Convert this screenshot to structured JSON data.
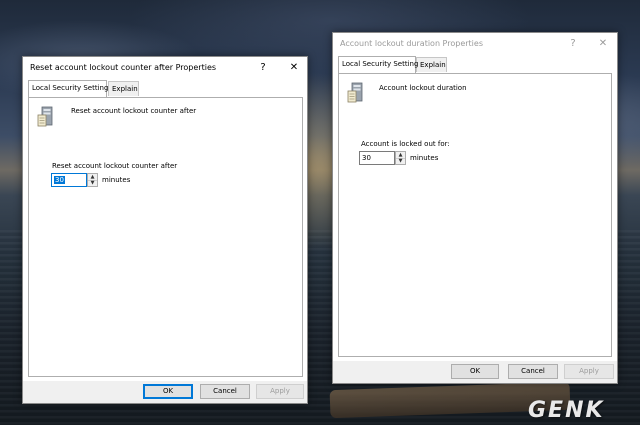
{
  "dialogs": {
    "left": {
      "title": "Reset account lockout counter after Properties",
      "help": "?",
      "close": "✕",
      "tabs": [
        "Local Security Setting",
        "Explain"
      ],
      "policy_name": "Reset account lockout counter after",
      "field_label": "Reset account lockout counter after",
      "value": "30",
      "unit": "minutes",
      "buttons": {
        "ok": "OK",
        "cancel": "Cancel",
        "apply": "Apply"
      }
    },
    "right": {
      "title": "Account lockout duration Properties",
      "help": "?",
      "close": "✕",
      "tabs": [
        "Local Security Setting",
        "Explain"
      ],
      "policy_name": "Account lockout duration",
      "field_label": "Account is locked out for:",
      "value": "30",
      "unit": "minutes",
      "buttons": {
        "ok": "OK",
        "cancel": "Cancel",
        "apply": "Apply"
      }
    }
  },
  "watermark": "GENK",
  "colors": {
    "accent": "#0078d7",
    "disabled_text": "#9c9c9c"
  }
}
